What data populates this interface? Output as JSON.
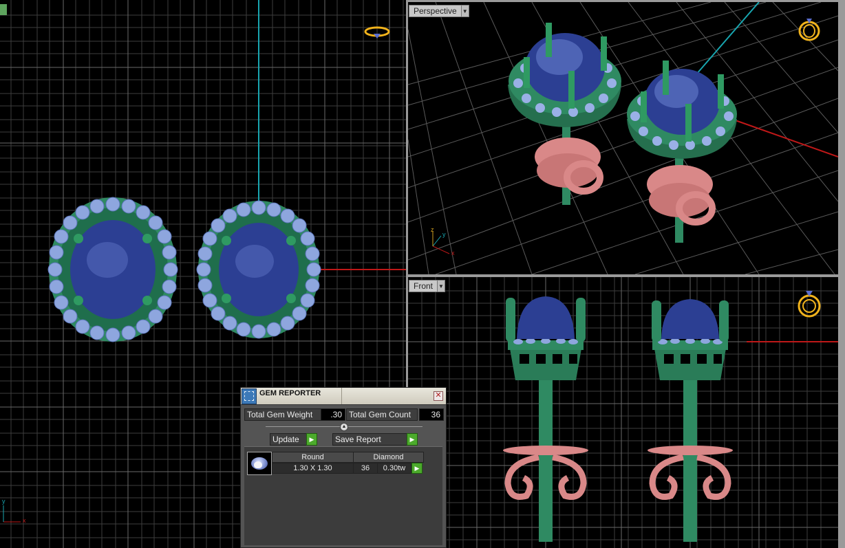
{
  "viewports": {
    "top": {
      "label": ""
    },
    "perspective": {
      "label": "Perspective"
    },
    "front": {
      "label": "Front"
    }
  },
  "axis_labels": {
    "x": "x",
    "y": "y",
    "z": "z"
  },
  "gem_reporter": {
    "title": "GEM REPORTER",
    "close_glyph": "✕",
    "total_gem_weight_label": "Total Gem Weight",
    "total_gem_weight_value": ".30",
    "total_gem_count_label": "Total Gem Count",
    "total_gem_count_value": "36",
    "update_label": "Update",
    "save_report_label": "Save Report",
    "gems": [
      {
        "shape": "Round",
        "material": "Diamond",
        "size": "1.30 X 1.30",
        "count": "36",
        "weight": "0.30tw"
      }
    ]
  },
  "colors": {
    "metal_green": "#2f8a62",
    "metal_pink": "#d98888",
    "center_stone": "#2c3f93",
    "side_stone": "#8ea6de",
    "grid_line": "#4a4a4a",
    "x_axis": "#c01818",
    "y_axis": "#18a6b0",
    "go_button": "#4caa2c",
    "ring_icon": "#f1b31c"
  }
}
